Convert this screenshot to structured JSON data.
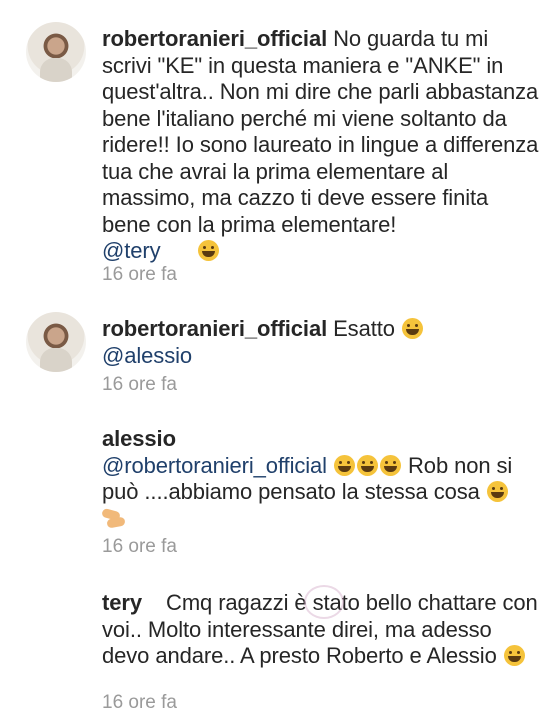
{
  "comments": [
    {
      "username": "robertoranieri_official",
      "body": "No guarda tu mi scrivi \"KE\" in questa maniera e \"ANKE\" in quest'altra.. Non mi dire che parli abbastanza bene l'italiano perché mi viene soltanto da ridere!! Io sono laureato in lingue a differenza tua che avrai la prima elementare al massimo, ma cazzo ti deve essere finita bene con la prima elementare!",
      "mention": "@tery",
      "time": "16 ore fa"
    },
    {
      "username": "robertoranieri_official",
      "body": "Esatto",
      "mention": "@alessio",
      "time": "16 ore fa"
    },
    {
      "username": "alessio",
      "mention": "@robertoranieri_official",
      "body": "Rob non si può ....abbiamo pensato la stessa cosa",
      "time": "16 ore fa"
    },
    {
      "username": "tery",
      "body": "Cmq ragazzi è stato bello chattare con voi.. Molto interessante direi, ma adesso devo andare.. A presto Roberto e Alessio",
      "time": "16 ore fa"
    }
  ],
  "icons": {
    "laugh": "grinning-squinting-face-icon",
    "hands": "clapping-hands-icon"
  }
}
